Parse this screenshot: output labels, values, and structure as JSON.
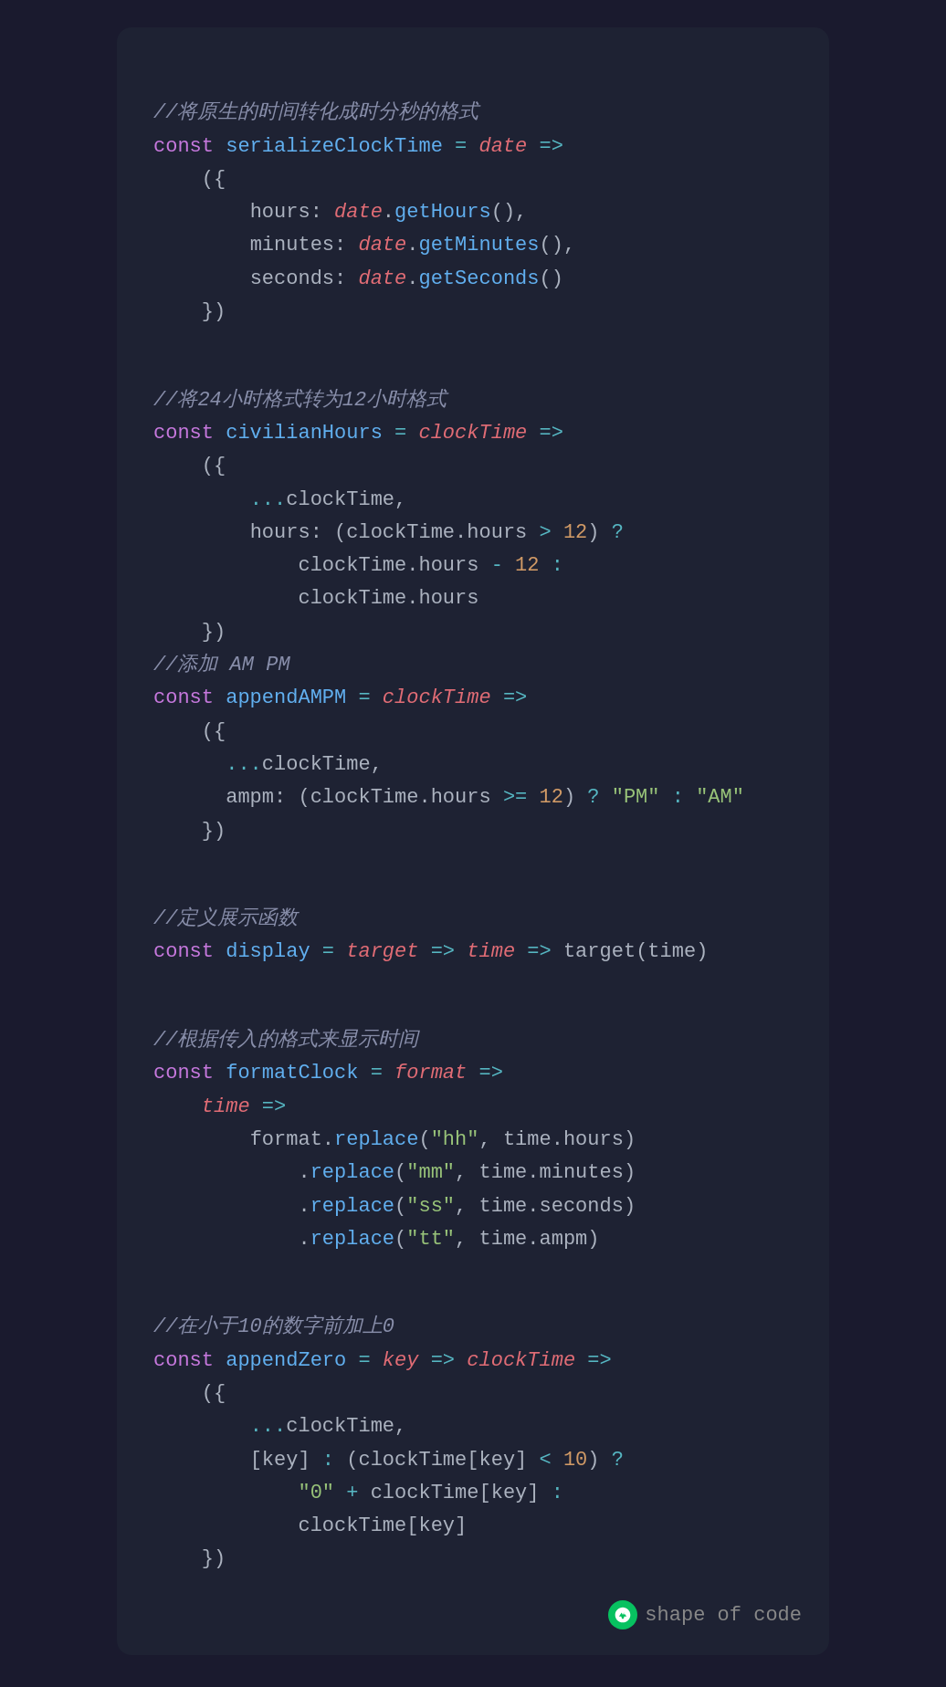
{
  "watermark": {
    "icon": "wechat",
    "text": "shape of code"
  },
  "code_sections": [
    {
      "comment": "//将原生的时间转化成时分秒的格式",
      "lines": [
        "const serializeClockTime = date =>",
        "    ({",
        "        hours: date.getHours(),",
        "        minutes: date.getMinutes(),",
        "        seconds: date.getSeconds()",
        "    })"
      ]
    },
    {
      "comment": "//将24小时格式转为12小时格式",
      "lines": [
        "const civilianHours = clockTime =>",
        "    ({",
        "        ...clockTime,",
        "        hours: (clockTime.hours > 12) ?",
        "            clockTime.hours - 12 :",
        "            clockTime.hours",
        "    })",
        "//添加 AM PM",
        "const appendAMPM = clockTime =>",
        "    ({",
        "      ...clockTime,",
        "      ampm: (clockTime.hours >= 12) ? \"PM\" : \"AM\"",
        "    })"
      ]
    },
    {
      "comment": "//定义展示函数",
      "lines": [
        "const display = target => time => target(time)"
      ]
    },
    {
      "comment": "//根据传入的格式来显示时间",
      "lines": [
        "const formatClock = format =>",
        "    time =>",
        "        format.replace(\"hh\", time.hours)",
        "            .replace(\"mm\", time.minutes)",
        "            .replace(\"ss\", time.seconds)",
        "            .replace(\"tt\", time.ampm)"
      ]
    },
    {
      "comment": "//在小于10的数字前加上0",
      "lines": [
        "const appendZero = key => clockTime =>",
        "    ({",
        "        ...clockTime,",
        "        [key] : (clockTime[key] < 10) ?",
        "            \"0\" + clockTime[key] :",
        "            clockTime[key]",
        "    })"
      ]
    }
  ]
}
